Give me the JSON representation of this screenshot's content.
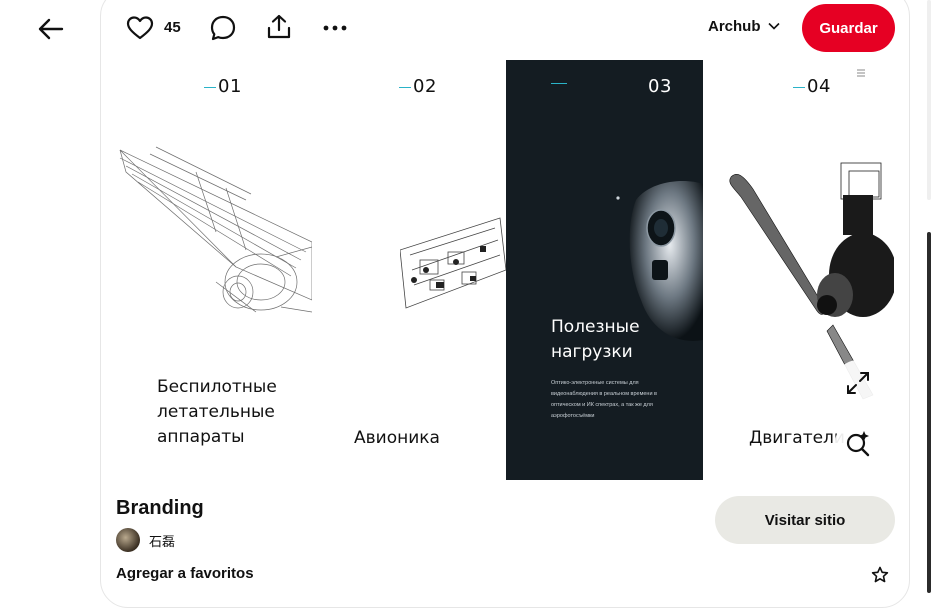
{
  "toolbar": {
    "like_count": "45",
    "board_name": "Archub",
    "save_label": "Guardar"
  },
  "pin": {
    "panels": [
      {
        "num": "01",
        "title": "Беспилотные\nлетательные\nаппараты"
      },
      {
        "num": "02",
        "title": "Авионика"
      },
      {
        "num": "03",
        "title": "Полезные\nнагрузки",
        "description": "Оптико-электронные системы для видеонаблюдения в реальном времени в оптическом и ИК спектрах, а так же для аэрофотосъёмки"
      },
      {
        "num": "04",
        "title": "Двигатели"
      }
    ],
    "accent_color": "#2ab3c8",
    "dark_panel_color": "#141c22"
  },
  "details": {
    "title": "Branding",
    "visit_label": "Visitar sitio",
    "author_name": "石磊",
    "favorites_label": "Agregar a favoritos"
  },
  "colors": {
    "save": "#e60023",
    "visit_bg": "#e9e9e4"
  },
  "icons": [
    "back-arrow-icon",
    "heart-icon",
    "comment-icon",
    "share-icon",
    "more-icon",
    "chevron-down-icon",
    "expand-icon",
    "visual-search-icon",
    "star-icon"
  ]
}
